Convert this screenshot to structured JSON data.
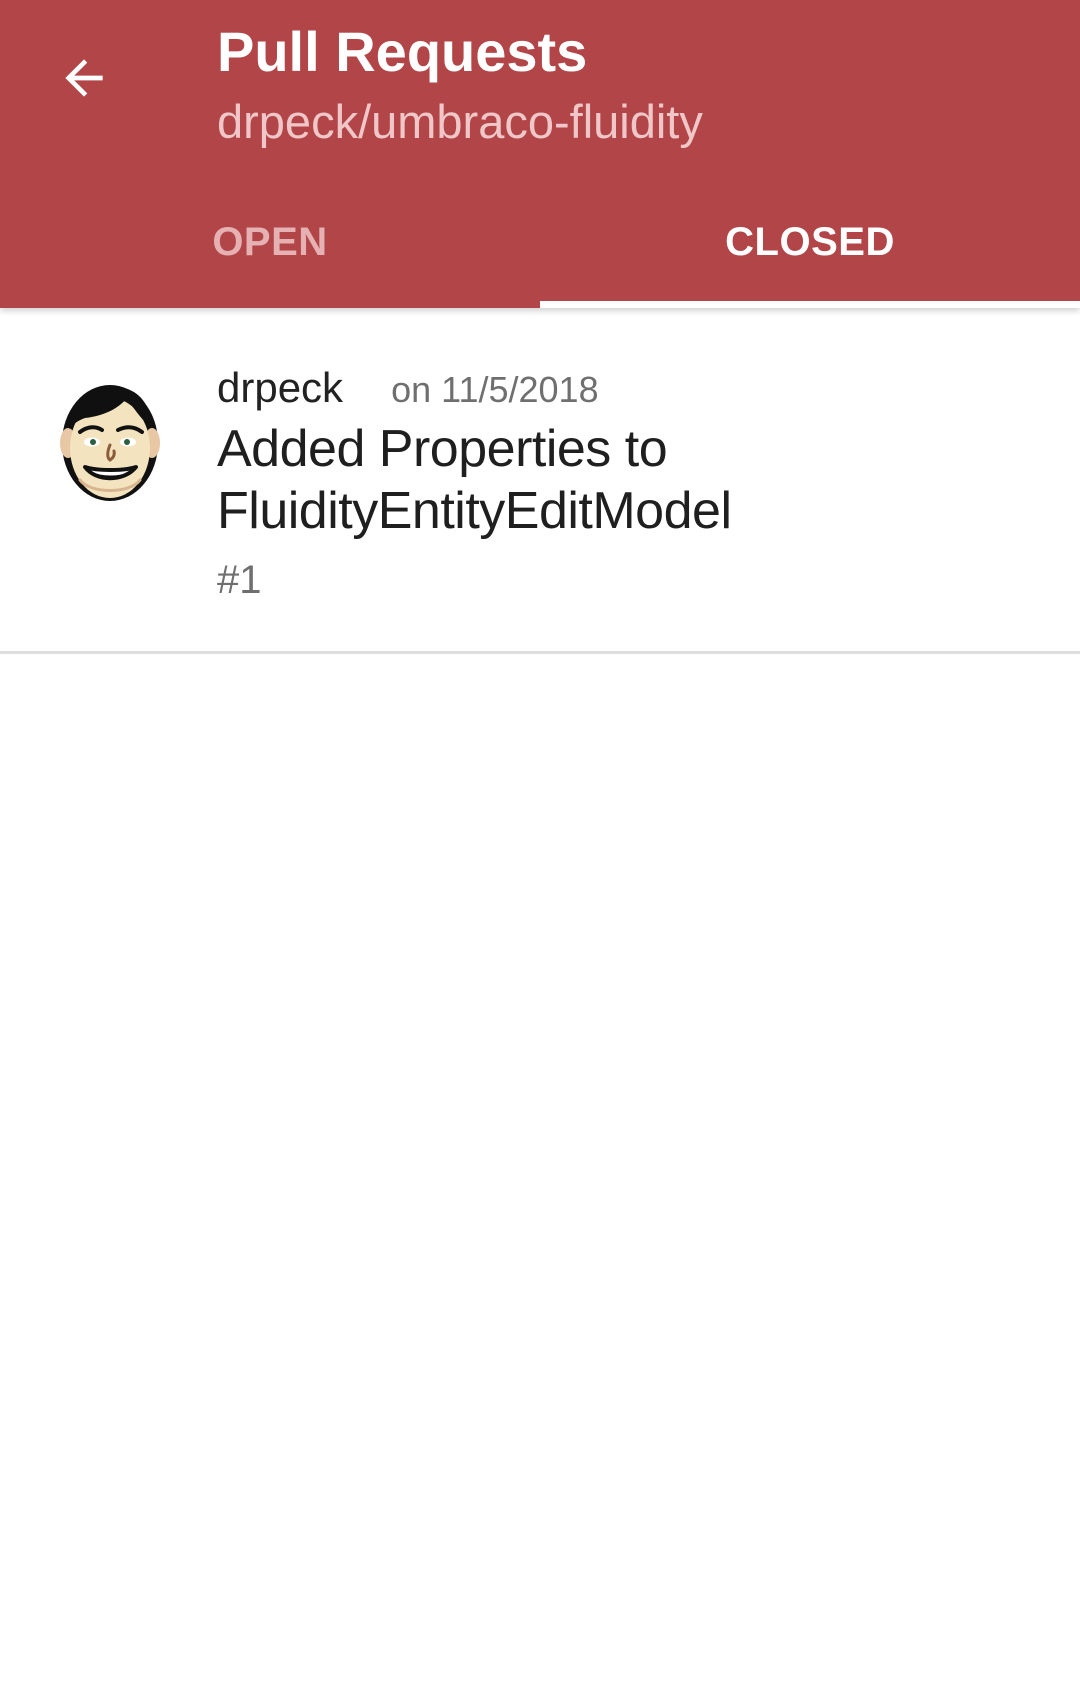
{
  "colors": {
    "header_background": "#b24548",
    "header_title": "#ffffff",
    "header_subtitle": "#f0c7c8",
    "tab_inactive": "#e6b1b2",
    "tab_active": "#ffffff",
    "divider": "#dddddd"
  },
  "header": {
    "back_icon": "arrow-left-icon",
    "title": "Pull Requests",
    "subtitle": "drpeck/umbraco-fluidity"
  },
  "tabs": [
    {
      "label": "OPEN",
      "active": false
    },
    {
      "label": "CLOSED",
      "active": true
    }
  ],
  "pull_requests": [
    {
      "avatar_icon": "cartoon-avatar-icon",
      "author": "drpeck",
      "date": "on 11/5/2018",
      "title": "Added Properties to FluidityEntityEditModel",
      "number": "#1"
    }
  ]
}
